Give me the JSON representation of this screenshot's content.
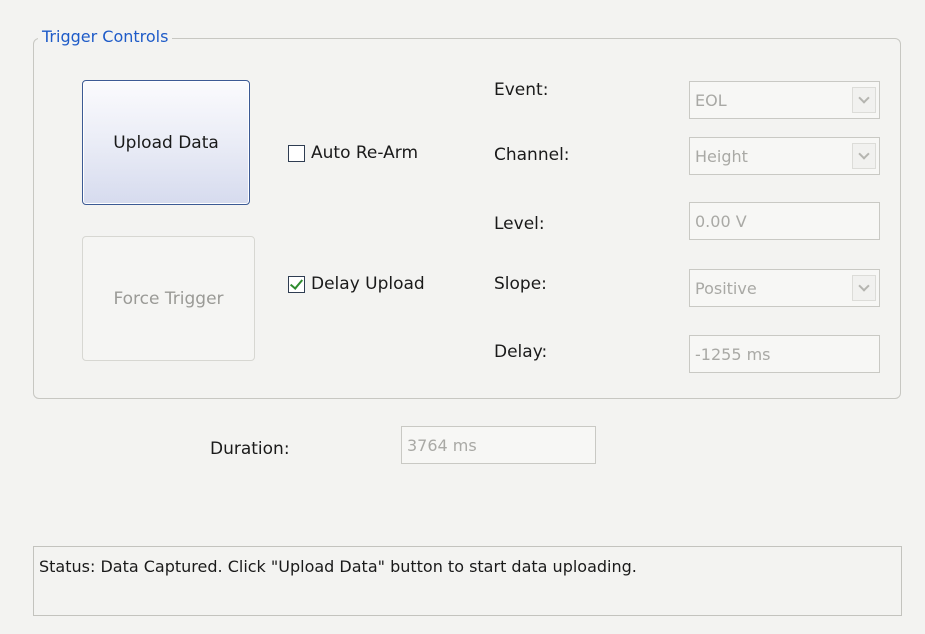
{
  "group": {
    "title": "Trigger Controls"
  },
  "buttons": {
    "upload": "Upload Data",
    "force_trigger": "Force Trigger"
  },
  "checkboxes": {
    "auto_rearm": {
      "label": "Auto Re-Arm",
      "checked": false
    },
    "delay_upload": {
      "label": "Delay Upload",
      "checked": true
    }
  },
  "fields": {
    "event": {
      "label": "Event:",
      "value": "EOL"
    },
    "channel": {
      "label": "Channel:",
      "value": "Height"
    },
    "level": {
      "label": "Level:",
      "value": "0.00 V"
    },
    "slope": {
      "label": "Slope:",
      "value": "Positive"
    },
    "delay": {
      "label": "Delay:",
      "value": "-1255 ms"
    }
  },
  "duration": {
    "label": "Duration:",
    "value": "3764 ms"
  },
  "status": {
    "text": "Status: Data Captured.  Click \"Upload Data\" button to start data uploading."
  },
  "icons": {
    "check": "checkmark-icon",
    "dropdown": "chevron-down-icon"
  },
  "colors": {
    "legend_blue": "#1e5bc8",
    "check_green": "#2e8b2e",
    "disabled_text": "#a9a9a5"
  }
}
